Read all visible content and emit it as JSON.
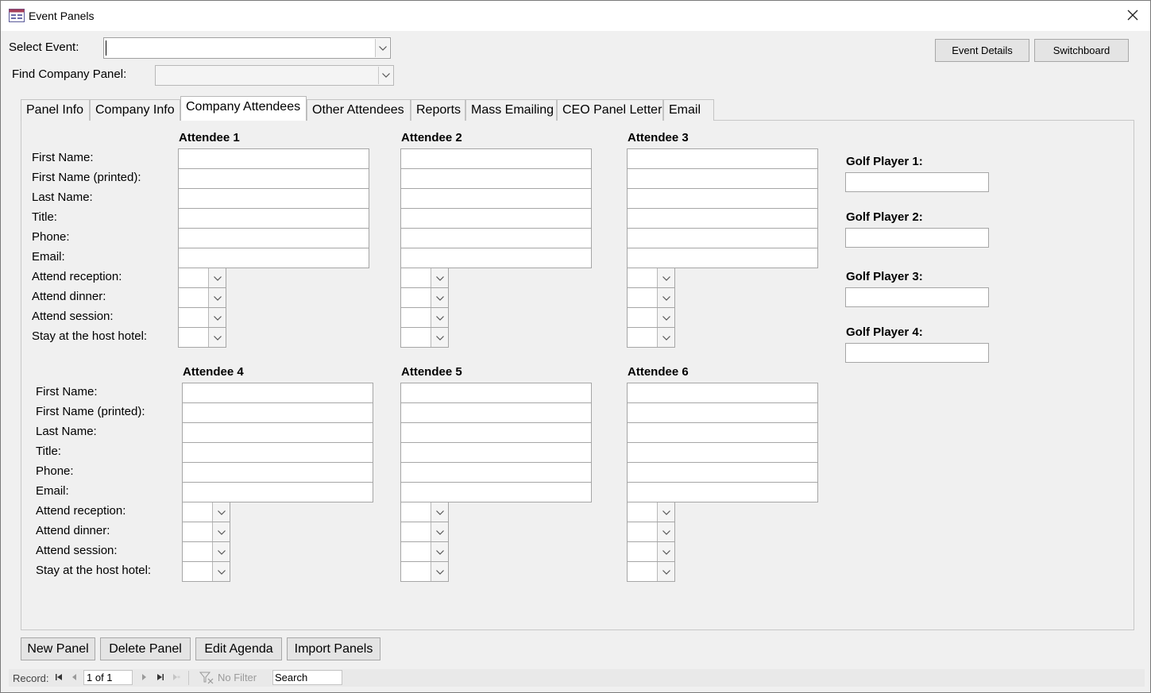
{
  "window": {
    "title": "Event Panels"
  },
  "header": {
    "select_event_label": "Select Event:",
    "find_company_label": "Find Company Panel:",
    "event_details_button": "Event Details",
    "switchboard_button": "Switchboard"
  },
  "tabs": [
    {
      "label": "Panel Info"
    },
    {
      "label": "Company Info"
    },
    {
      "label": "Company Attendees",
      "active": true
    },
    {
      "label": "Other Attendees"
    },
    {
      "label": "Reports"
    },
    {
      "label": "Mass Emailing"
    },
    {
      "label": "CEO Panel Letter"
    },
    {
      "label": "Email"
    }
  ],
  "field_labels": {
    "first_name": "First Name:",
    "first_name_printed": "First Name (printed):",
    "last_name": "Last Name:",
    "title": "Title:",
    "phone": "Phone:",
    "email": "Email:",
    "attend_reception": "Attend reception:",
    "attend_dinner": "Attend dinner:",
    "attend_session": "Attend session:",
    "stay_host_hotel": "Stay at the host hotel:"
  },
  "attendees": [
    {
      "heading": "Attendee 1"
    },
    {
      "heading": "Attendee 2"
    },
    {
      "heading": "Attendee 3"
    },
    {
      "heading": "Attendee 4"
    },
    {
      "heading": "Attendee 5"
    },
    {
      "heading": "Attendee 6"
    }
  ],
  "golf_players": [
    {
      "label": "Golf Player 1:"
    },
    {
      "label": "Golf Player 2:"
    },
    {
      "label": "Golf Player 3:"
    },
    {
      "label": "Golf Player 4:"
    }
  ],
  "bottom_buttons": {
    "new_panel": "New Panel",
    "delete_panel": "Delete Panel",
    "edit_agenda": "Edit Agenda",
    "import_panels": "Import Panels"
  },
  "navigation": {
    "record_label": "Record:",
    "record_value": "1 of 1",
    "no_filter": "No Filter",
    "search_value": "Search"
  },
  "colors": {
    "background": "#f0f0f0",
    "titlebar": "#ffffff",
    "field_border": "#a6a6a6"
  }
}
